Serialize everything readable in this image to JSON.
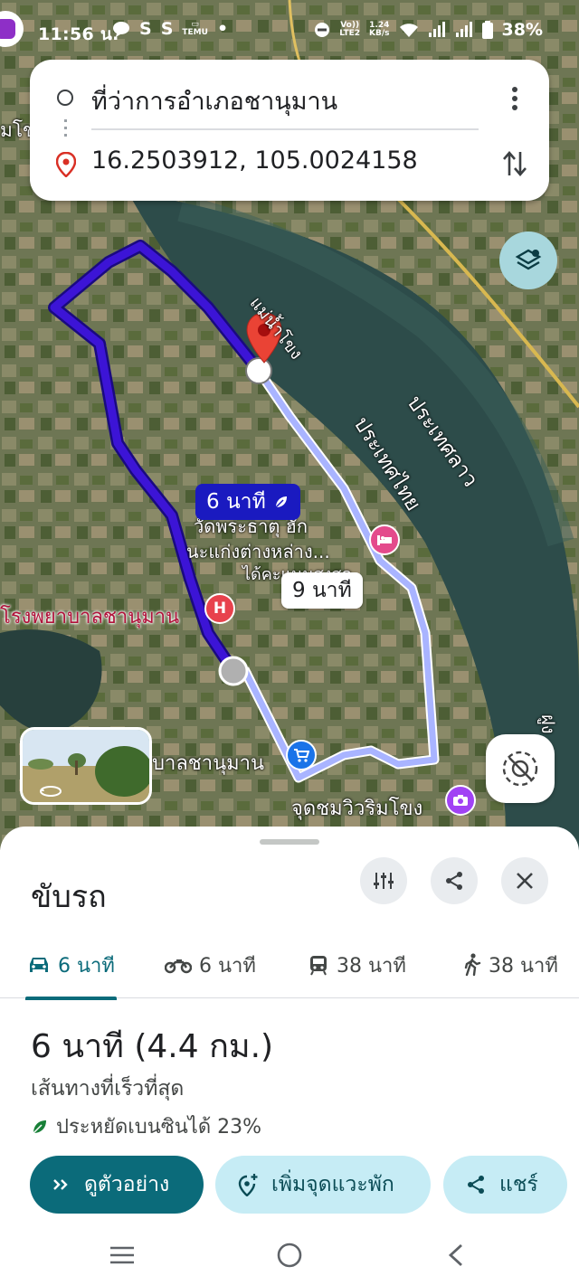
{
  "status_bar": {
    "time": "11:56 น.",
    "left_icons": [
      "chat-icon",
      "S",
      "S",
      "temu-icon",
      "•"
    ],
    "network_label_top": "Vo))",
    "network_label_bottom": "LTE2",
    "speed_top": "1.24",
    "speed_bottom": "KB/s",
    "battery": "38%"
  },
  "route_card": {
    "origin": "ที่ว่าการอำเภอชานุมาน",
    "destination": "16.2503912, 105.0024158"
  },
  "map": {
    "labels": {
      "mekong": "แม่น้ำโขง",
      "laos": "ประเทศลาว",
      "thailand": "ประเทศไทย",
      "hospital": "โรงพยาบาลชานุมาน",
      "poi_line1": "วัดพระธาตุ ฮัก",
      "poi_line2": "นะแก่งต่างหล่าง...",
      "poi_line3": "ได้คะแนนสูงสุด",
      "market": "บาลชานุมาน",
      "viewpoint": "จุดชมวิวริมโขง",
      "left_edge": "มโข",
      "right_edge": "ฝูง"
    },
    "primary_time": "6 นาที",
    "alt_time": "9 นาที",
    "colors": {
      "primary_route": "#3c14d6",
      "alt_route": "#a9b4ff",
      "pin": "#ea4335"
    }
  },
  "sheet": {
    "title": "ขับรถ",
    "modes": [
      {
        "icon": "car-icon",
        "label": "6 นาที"
      },
      {
        "icon": "motorcycle-icon",
        "label": "6 นาที"
      },
      {
        "icon": "transit-icon",
        "label": "38 นาที"
      },
      {
        "icon": "walk-icon",
        "label": "38 นาที"
      }
    ],
    "summary": "6 นาที (4.4 กม.)",
    "subtitle": "เส้นทางที่เร็วที่สุด",
    "eco": "ประหยัดเบนซินได้ 23%",
    "buttons": {
      "preview": "ดูตัวอย่าง",
      "add_stop": "เพิ่มจุดแวะพัก",
      "share": "แชร์"
    }
  }
}
